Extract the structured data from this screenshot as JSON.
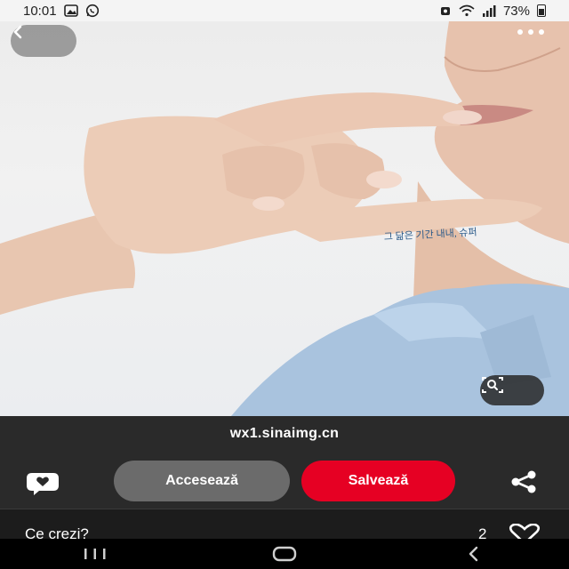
{
  "status_bar": {
    "time": "10:01",
    "battery": "73%",
    "notification_icons": [
      "gallery-icon",
      "whatsapp-icon"
    ],
    "system_icons": [
      "alarm-icon",
      "wifi-icon",
      "signal-icon",
      "battery-icon"
    ]
  },
  "photo": {
    "caption_handwriting": "그 닮은 기간 내내, 슈퍼",
    "back_icon": "chevron-left-icon",
    "more_icon": "more-horizontal-icon",
    "lens_icon": "visual-search-icon"
  },
  "panel": {
    "source_url": "wx1.sinaimg.cn",
    "visit_label": "Accesează",
    "save_label": "Salvează",
    "comment_icon": "comment-heart-icon",
    "share_icon": "share-icon"
  },
  "comments": {
    "prompt": "Ce crezi?",
    "like_count": "2",
    "heart_icon": "heart-outline-icon"
  },
  "colors": {
    "save_button": "#e60023",
    "visit_button": "#6b6b6b",
    "panel_bg": "#2a2a2a"
  },
  "nav_bar": {
    "icons": [
      "recent-apps-icon",
      "home-icon",
      "back-icon"
    ]
  }
}
